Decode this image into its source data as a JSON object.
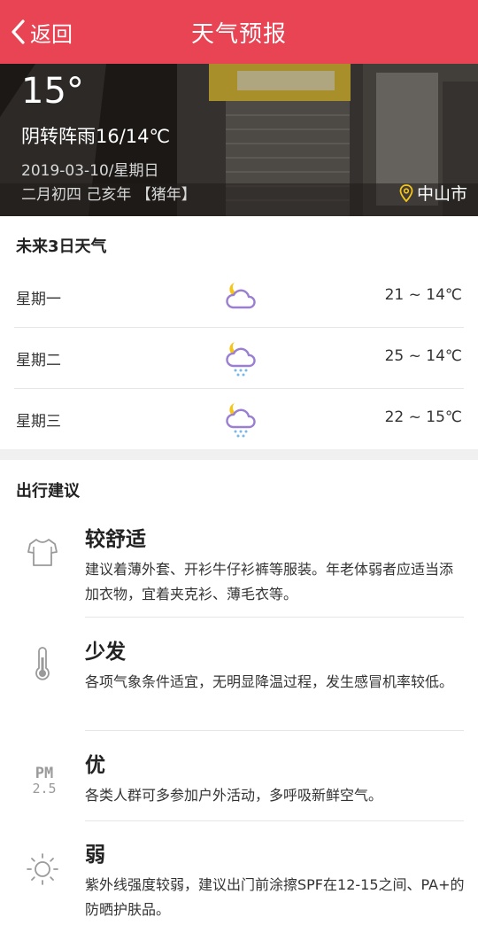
{
  "header": {
    "back_label": "返回",
    "title": "天气预报"
  },
  "current": {
    "temp": "15°",
    "desc": "阴转阵雨16/14℃",
    "date": "2019-03-10/星期日",
    "lunar": "二月初四 己亥年 【猪年】",
    "city": "中山市"
  },
  "forecast": {
    "title": "未来3日天气",
    "days": [
      {
        "day": "星期一",
        "icon": "partly-cloudy-night-icon",
        "temp": "21 ~ 14℃"
      },
      {
        "day": "星期二",
        "icon": "night-snow-icon",
        "temp": "25 ~ 14℃"
      },
      {
        "day": "星期三",
        "icon": "night-snow-icon",
        "temp": "22 ~ 15℃"
      }
    ]
  },
  "advice": {
    "title": "出行建议",
    "items": [
      {
        "icon": "tshirt-icon",
        "heading": "较舒适",
        "body": "建议着薄外套、开衫牛仔衫裤等服装。年老体弱者应适当添加衣物，宜着夹克衫、薄毛衣等。"
      },
      {
        "icon": "thermometer-icon",
        "heading": "少发",
        "body": "各项气象条件适宜，无明显降温过程，发生感冒机率较低。"
      },
      {
        "icon": "pm25-icon",
        "heading": "优",
        "body": "各类人群可多参加户外活动，多呼吸新鲜空气。",
        "pm_top": "PM",
        "pm_bottom": "2.5"
      },
      {
        "icon": "sun-icon",
        "heading": "弱",
        "body": "紫外线强度较弱，建议出门前涂擦SPF在12-15之间、PA+的防晒护肤品。"
      }
    ]
  },
  "colors": {
    "header": "#e84453",
    "icon_purple": "#9a7fd1",
    "moon_yellow": "#f5c518"
  }
}
